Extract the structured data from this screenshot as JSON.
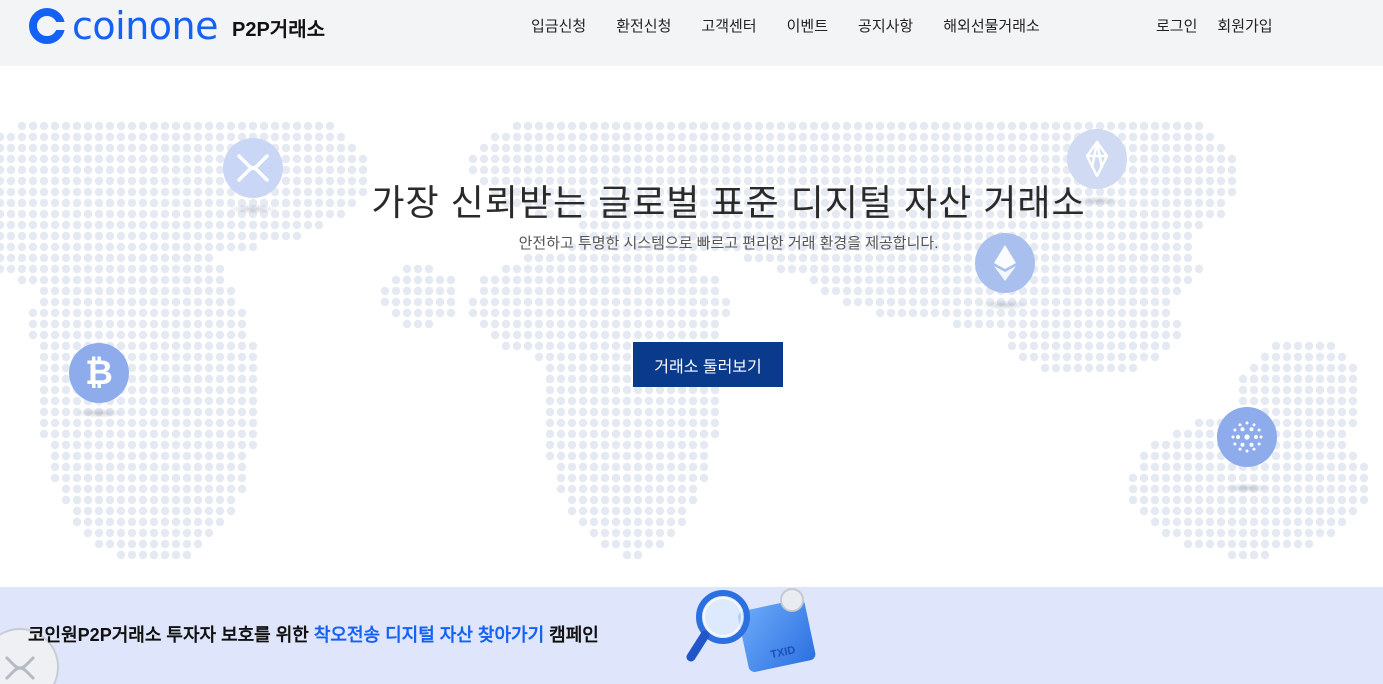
{
  "brand": {
    "name": "coinone",
    "sub": "P2P거래소"
  },
  "nav": {
    "items": [
      "입금신청",
      "환전신청",
      "고객센터",
      "이벤트",
      "공지사항",
      "해외선물거래소"
    ]
  },
  "auth": {
    "login": "로그인",
    "signup": "회원가입"
  },
  "hero": {
    "title": "가장 신뢰받는 글로벌 표준 디지털 자산 거래소",
    "subtitle": "안전하고 투명한 시스템으로 빠르고 편리한 거래 환경을 제공합니다.",
    "cta": "거래소 둘러보기"
  },
  "coins": [
    "xrp-icon",
    "eos-icon",
    "ethereum-icon",
    "bitcoin-icon",
    "cardano-icon"
  ],
  "banner": {
    "prefix": "코인원P2P거래소 투자자 보호를 위한 ",
    "highlight": "착오전송 디지털 자산 찾아가기",
    "suffix": " 캠페인",
    "illustration_label": "TXID"
  },
  "colors": {
    "brand": "#1461f5",
    "cta": "#0a3a8c",
    "banner_bg": "#dfe6fb",
    "header_bg": "#f3f4f6"
  }
}
